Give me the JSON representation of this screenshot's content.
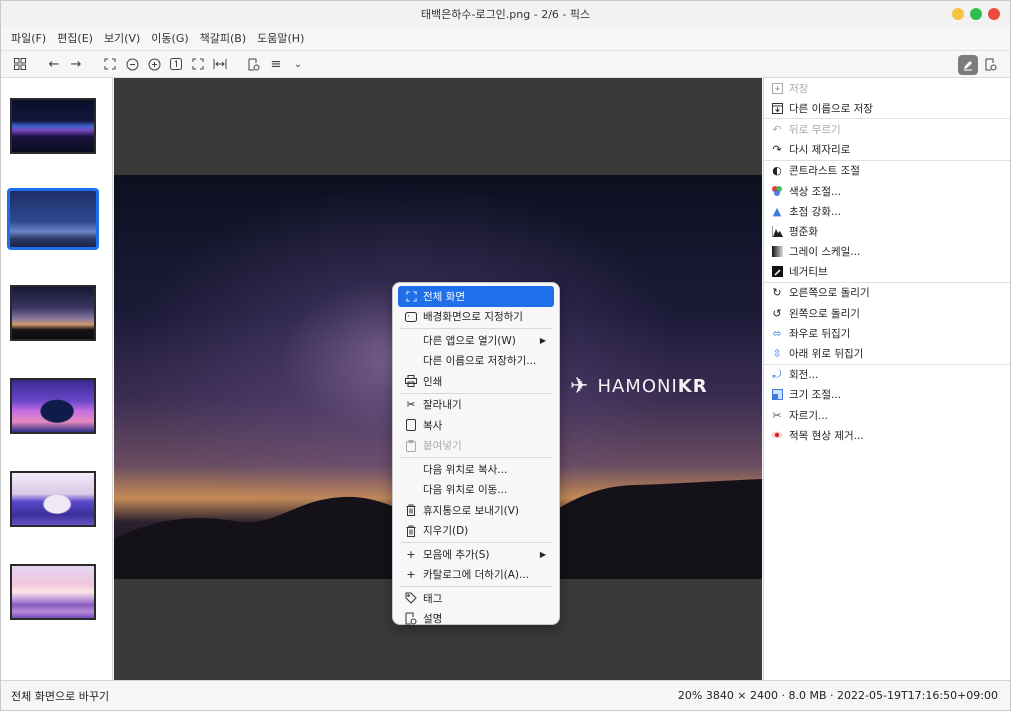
{
  "window": {
    "title": "태백은하수-로그인.png - 2/6 - 픽스"
  },
  "menu": [
    "파일(F)",
    "편집(E)",
    "보기(V)",
    "이동(G)",
    "책갈피(B)",
    "도움말(H)"
  ],
  "toolbar": {
    "icons": [
      "grid-icon",
      "back-arrow-icon",
      "forward-arrow-icon",
      "fullscreen-icon",
      "zoom-out-icon",
      "zoom-in-icon",
      "actual-size-icon",
      "fit-icon",
      "fit-width-icon",
      "properties-icon",
      "sort-icon",
      "chevron-down-icon",
      "edit-mode-icon",
      "info-icon"
    ]
  },
  "thumbnails": [
    {
      "name": "thumb-1"
    },
    {
      "name": "thumb-2",
      "selected": true
    },
    {
      "name": "thumb-3"
    },
    {
      "name": "thumb-4"
    },
    {
      "name": "thumb-5"
    },
    {
      "name": "thumb-6"
    }
  ],
  "image": {
    "brand_text": "HAMONI",
    "brand_suffix": "KR"
  },
  "context_menu": {
    "items": [
      {
        "label": "전체 화면",
        "icon": "fullscreen-icon",
        "highlight": true
      },
      {
        "label": "배경화면으로 지정하기",
        "icon": "wallpaper-icon"
      },
      {
        "sep": true
      },
      {
        "label": "다른 앱으로 열기(W)",
        "submenu": true
      },
      {
        "label": "다른 이름으로 저장하기..."
      },
      {
        "label": "인쇄",
        "icon": "printer-icon"
      },
      {
        "sep": true
      },
      {
        "label": "잘라내기",
        "icon": "scissors-icon"
      },
      {
        "label": "복사",
        "icon": "copy-icon"
      },
      {
        "label": "붙여넣기",
        "icon": "paste-icon",
        "disabled": true
      },
      {
        "sep": true
      },
      {
        "label": "다음 위치로 복사..."
      },
      {
        "label": "다음 위치로 이동..."
      },
      {
        "label": "휴지통으로 보내기(V)",
        "icon": "trash-icon"
      },
      {
        "label": "지우기(D)",
        "icon": "trash-icon"
      },
      {
        "sep": true
      },
      {
        "label": "모음에 추가(S)",
        "icon": "plus-icon",
        "submenu": true
      },
      {
        "label": "카탈로그에 더하기(A)...",
        "icon": "plus-icon"
      },
      {
        "sep": true
      },
      {
        "label": "태그",
        "icon": "tag-icon"
      },
      {
        "label": "설명",
        "icon": "description-icon"
      }
    ]
  },
  "panel": {
    "items": [
      {
        "label": "저장",
        "icon": "save-icon",
        "disabled": true
      },
      {
        "label": "다른 이름으로 저장",
        "icon": "save-as-icon"
      },
      {
        "sep": true
      },
      {
        "label": "뒤로 무르기",
        "icon": "undo-icon",
        "disabled": true
      },
      {
        "label": "다시 제자리로",
        "icon": "redo-icon"
      },
      {
        "sep": true
      },
      {
        "label": "콘트라스트 조절",
        "icon": "contrast-icon"
      },
      {
        "label": "색상 조절...",
        "icon": "color-icon"
      },
      {
        "label": "초점 강화...",
        "icon": "sharpen-icon"
      },
      {
        "label": "평준화",
        "icon": "equalize-icon"
      },
      {
        "label": "그레이 스케일...",
        "icon": "grayscale-icon"
      },
      {
        "label": "네거티브",
        "icon": "negative-icon"
      },
      {
        "sep": true
      },
      {
        "label": "오른쪽으로 돌리기",
        "icon": "rotate-right-icon"
      },
      {
        "label": "왼쪽으로 돌리기",
        "icon": "rotate-left-icon"
      },
      {
        "label": "좌우로 뒤집기",
        "icon": "flip-horizontal-icon"
      },
      {
        "label": "아래 위로 뒤집기",
        "icon": "flip-vertical-icon"
      },
      {
        "sep": true
      },
      {
        "label": "회전...",
        "icon": "rotate-icon"
      },
      {
        "label": "크기 조절...",
        "icon": "resize-icon"
      },
      {
        "label": "자르기...",
        "icon": "crop-icon"
      },
      {
        "label": "적목 현상 제거...",
        "icon": "red-eye-icon"
      }
    ]
  },
  "status": {
    "left": "전체 화면으로 바꾸기",
    "right": "20% 3840 × 2400 · 8.0 MB · 2022-05-19T17:16:50+09:00"
  },
  "colors": {
    "accent": "#1f6feb",
    "traffic_min": "#f5c242",
    "traffic_max": "#2ebd4e",
    "traffic_close": "#ee4a3e"
  }
}
